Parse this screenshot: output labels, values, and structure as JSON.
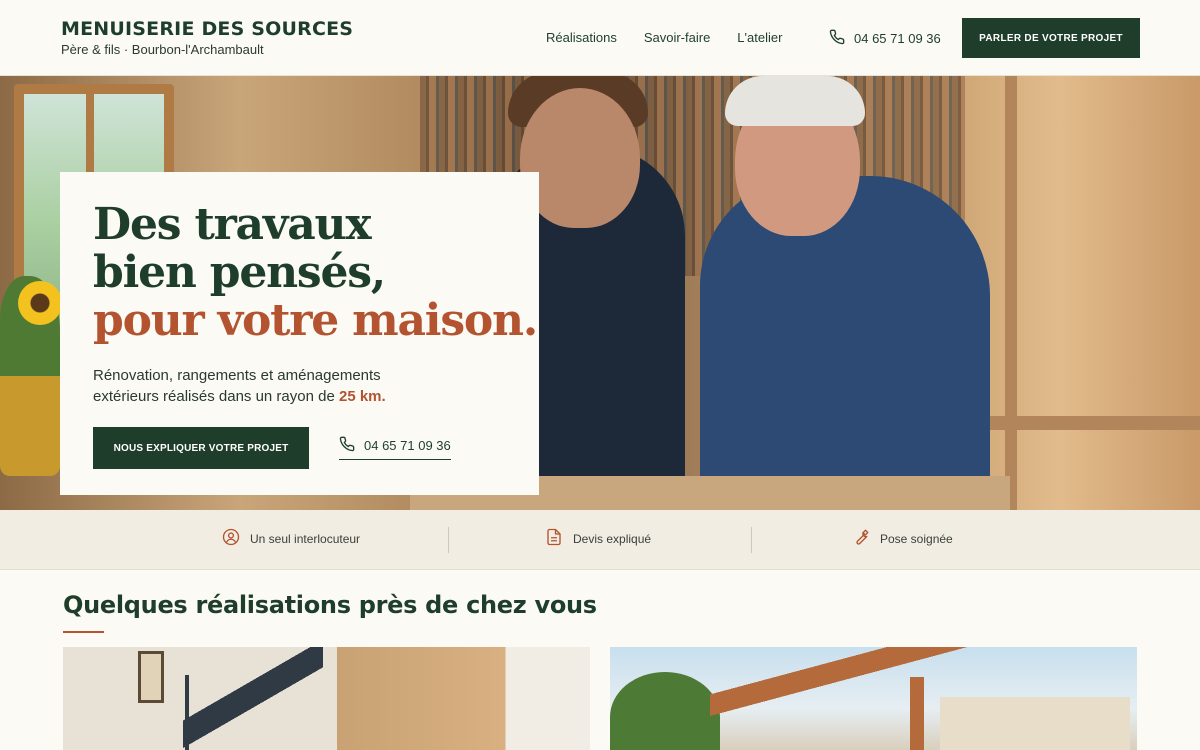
{
  "header": {
    "brand_name": "MENUISERIE DES SOURCES",
    "brand_sub": "Père & fils · Bourbon-l'Archambault",
    "nav": [
      "Réalisations",
      "Savoir-faire",
      "L'atelier"
    ],
    "phone": "04 65 71 09 36",
    "cta": "PARLER DE VOTRE PROJET"
  },
  "hero": {
    "title_line1": "Des travaux",
    "title_line2": "bien pensés,",
    "title_line3": "pour votre maison.",
    "desc_text": "Rénovation, rangements et aménagements extérieurs réalisés dans un rayon de",
    "desc_highlight": "25 km.",
    "cta": "NOUS EXPLIQUER VOTRE PROJET",
    "phone": "04 65 71 09 36"
  },
  "features": [
    {
      "label": "Un seul interlocuteur",
      "icon": "user-circle-icon"
    },
    {
      "label": "Devis expliqué",
      "icon": "document-icon"
    },
    {
      "label": "Pose soignée",
      "icon": "wrench-icon"
    }
  ],
  "section": {
    "title": "Quelques réalisations près de chez vous"
  },
  "colors": {
    "primary": "#1e3e2b",
    "accent": "#b3532f",
    "background": "#fbfaf5"
  }
}
